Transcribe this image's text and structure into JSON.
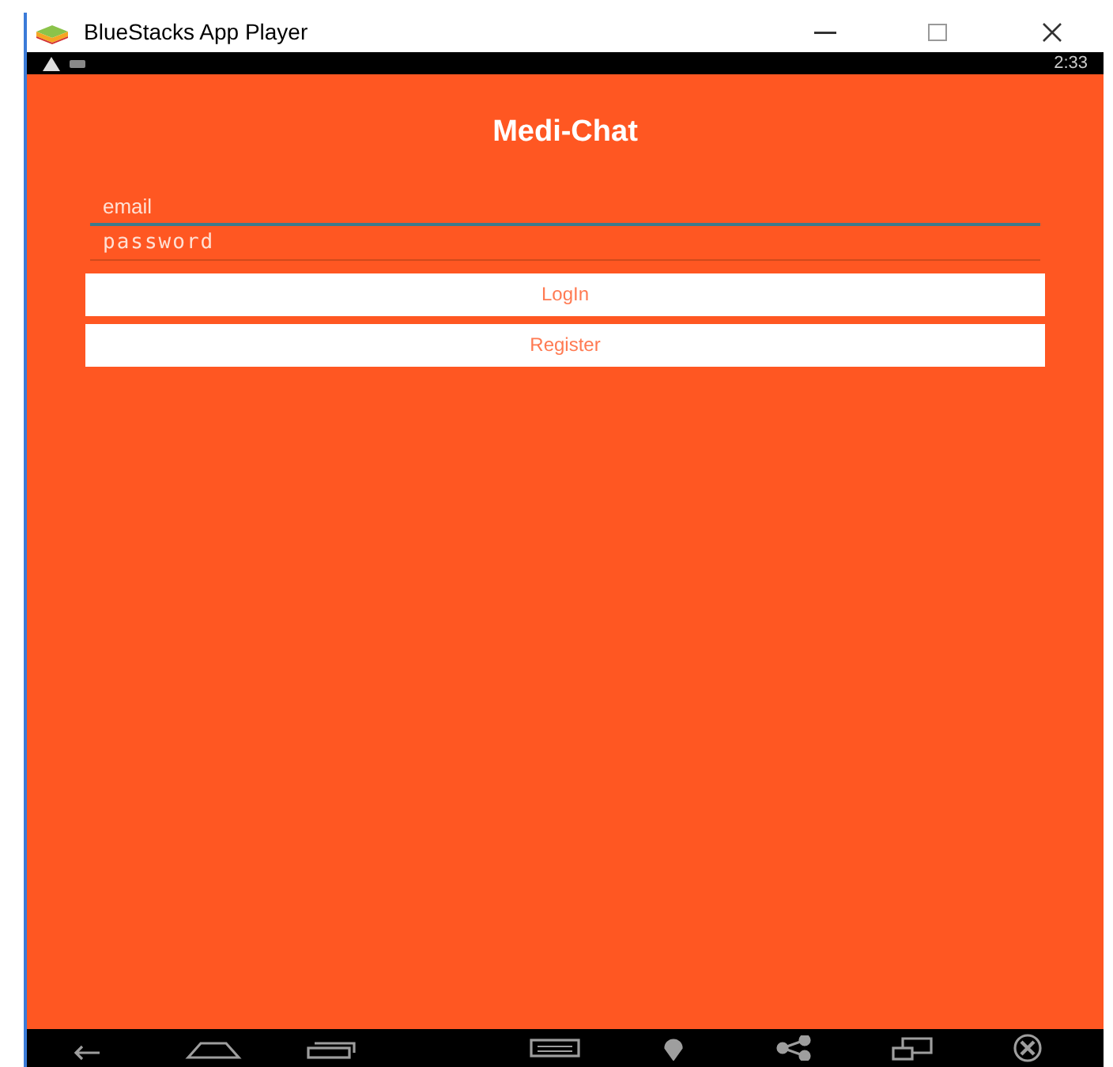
{
  "window": {
    "title": "BlueStacks App Player"
  },
  "status_bar": {
    "time": "2:33"
  },
  "app": {
    "title": "Medi-Chat"
  },
  "fields": [
    {
      "placeholder": "email",
      "focused": true,
      "kind": "text"
    },
    {
      "placeholder": "password",
      "focused": false,
      "kind": "password"
    }
  ],
  "buttons": [
    "LogIn",
    "Register"
  ]
}
